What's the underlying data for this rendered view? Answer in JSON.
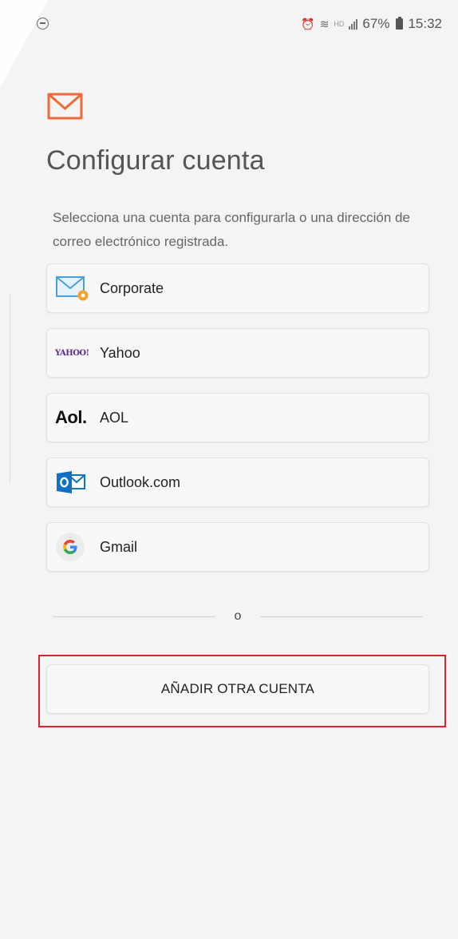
{
  "status_bar": {
    "battery_percent": "67%",
    "time": "15:32",
    "network_label": "HD"
  },
  "header": {
    "app_icon": "email-envelope-icon",
    "accent_color": "#f06a37",
    "title": "Configurar cuenta",
    "subtitle": "Selecciona una cuenta para configurarla o una dirección de correo electrónico registrada."
  },
  "accounts": [
    {
      "label": "Corporate",
      "icon": "corporate-mail-icon"
    },
    {
      "label": "Yahoo",
      "icon": "yahoo-logo",
      "logo_text": "YAHOO!"
    },
    {
      "label": "AOL",
      "icon": "aol-logo",
      "logo_text": "Aol."
    },
    {
      "label": "Outlook.com",
      "icon": "outlook-logo"
    },
    {
      "label": "Gmail",
      "icon": "google-logo"
    }
  ],
  "divider_text": "o",
  "add_account": {
    "label": "AÑADIR OTRA CUENTA",
    "highlight_color": "#d9232e"
  }
}
